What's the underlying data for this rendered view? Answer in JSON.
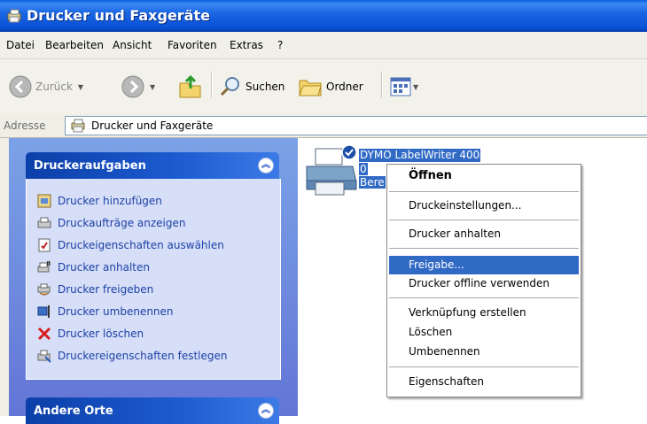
{
  "window": {
    "title": "Drucker und Faxgeräte"
  },
  "menu": [
    "Datei",
    "Bearbeiten",
    "Ansicht",
    "Favoriten",
    "Extras",
    "?"
  ],
  "toolbar": {
    "back": "Zurück",
    "search": "Suchen",
    "folders": "Ordner"
  },
  "address": {
    "label": "Adresse",
    "value": "Drucker und Faxgeräte"
  },
  "sidebar": {
    "tasks_title": "Druckeraufgaben",
    "tasks": [
      {
        "label": "Drucker hinzufügen",
        "icon": "add-printer-icon"
      },
      {
        "label": "Druckaufträge anzeigen",
        "icon": "print-queue-icon"
      },
      {
        "label": "Druckeigenschaften auswählen",
        "icon": "print-preferences-icon"
      },
      {
        "label": "Drucker anhalten",
        "icon": "pause-printer-icon"
      },
      {
        "label": "Drucker freigeben",
        "icon": "share-printer-icon"
      },
      {
        "label": "Drucker umbenennen",
        "icon": "rename-icon"
      },
      {
        "label": "Drucker löschen",
        "icon": "delete-x-icon"
      },
      {
        "label": "Druckereigenschaften festlegen",
        "icon": "printer-properties-icon"
      }
    ],
    "other_title": "Andere Orte"
  },
  "printer": {
    "name": "DYMO LabelWriter 400",
    "documents": "0",
    "status": "Bere"
  },
  "context_menu": {
    "open": "Öffnen",
    "preferences": "Druckeinstellungen...",
    "pause": "Drucker anhalten",
    "share": "Freigabe...",
    "offline": "Drucker offline verwenden",
    "shortcut": "Verknüpfung erstellen",
    "delete": "Löschen",
    "rename": "Umbenennen",
    "properties": "Eigenschaften"
  },
  "colors": {
    "title_blue": "#0a52d8",
    "selection": "#316ac5",
    "task_link": "#1c3fa6",
    "panel_bg": "#d6dff7"
  }
}
